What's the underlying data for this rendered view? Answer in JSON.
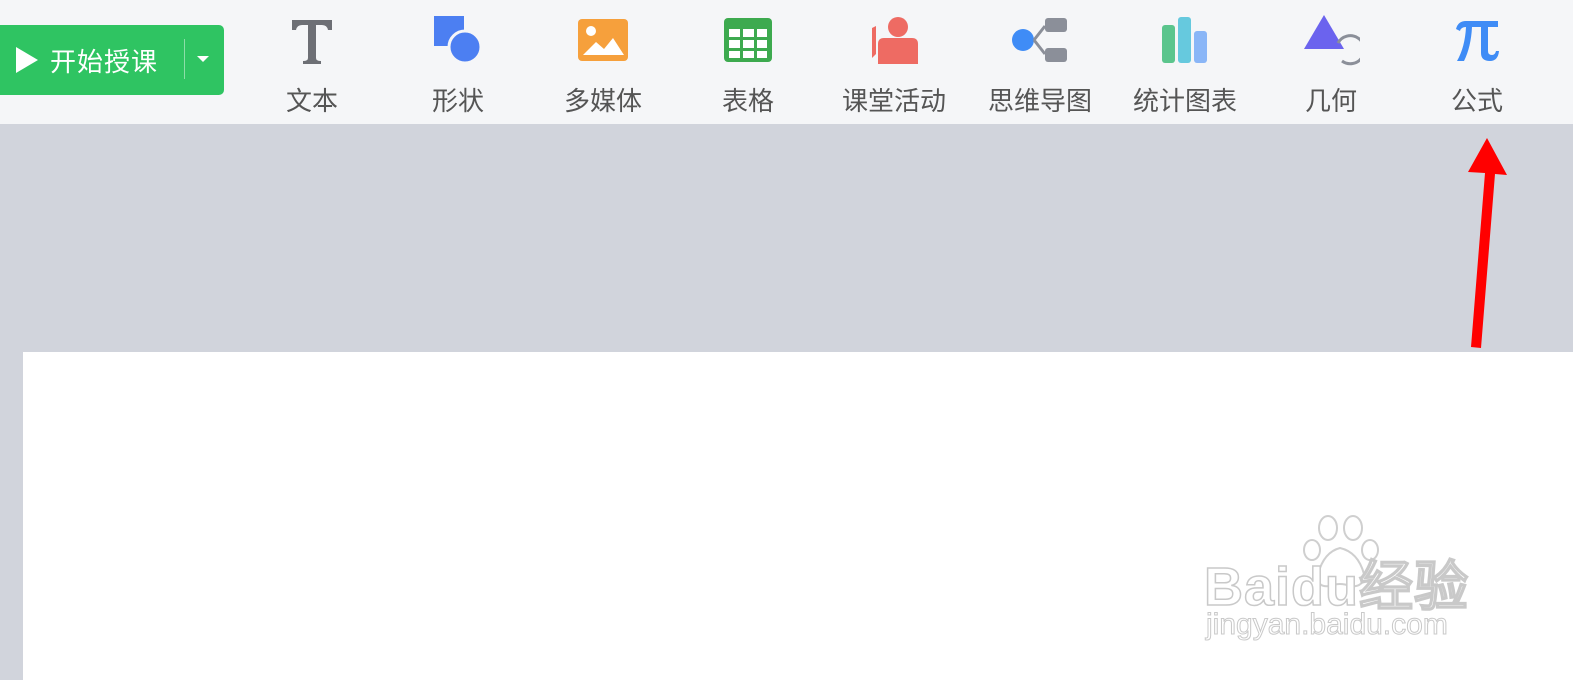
{
  "toolbar": {
    "start_button": {
      "label": "开始授课"
    },
    "tools": [
      {
        "id": "text",
        "label": "文本",
        "icon": "text-T-icon"
      },
      {
        "id": "shape",
        "label": "形状",
        "icon": "shape-icon"
      },
      {
        "id": "media",
        "label": "多媒体",
        "icon": "image-icon"
      },
      {
        "id": "table",
        "label": "表格",
        "icon": "table-icon"
      },
      {
        "id": "activity",
        "label": "课堂活动",
        "icon": "teacher-icon"
      },
      {
        "id": "mindmap",
        "label": "思维导图",
        "icon": "mindmap-icon"
      },
      {
        "id": "chart",
        "label": "统计图表",
        "icon": "bar-chart-icon"
      },
      {
        "id": "geometry",
        "label": "几何",
        "icon": "triangle-icon"
      },
      {
        "id": "formula",
        "label": "公式",
        "icon": "pi-icon"
      }
    ]
  },
  "colors": {
    "start_green": "#2fc462",
    "accent_blue": "#3f8cf6",
    "arrow_red": "#ff0000",
    "workspace_gray": "#d1d4dc"
  },
  "watermark": {
    "brand": "Baidu经验",
    "url": "jingyan.baidu.com"
  }
}
